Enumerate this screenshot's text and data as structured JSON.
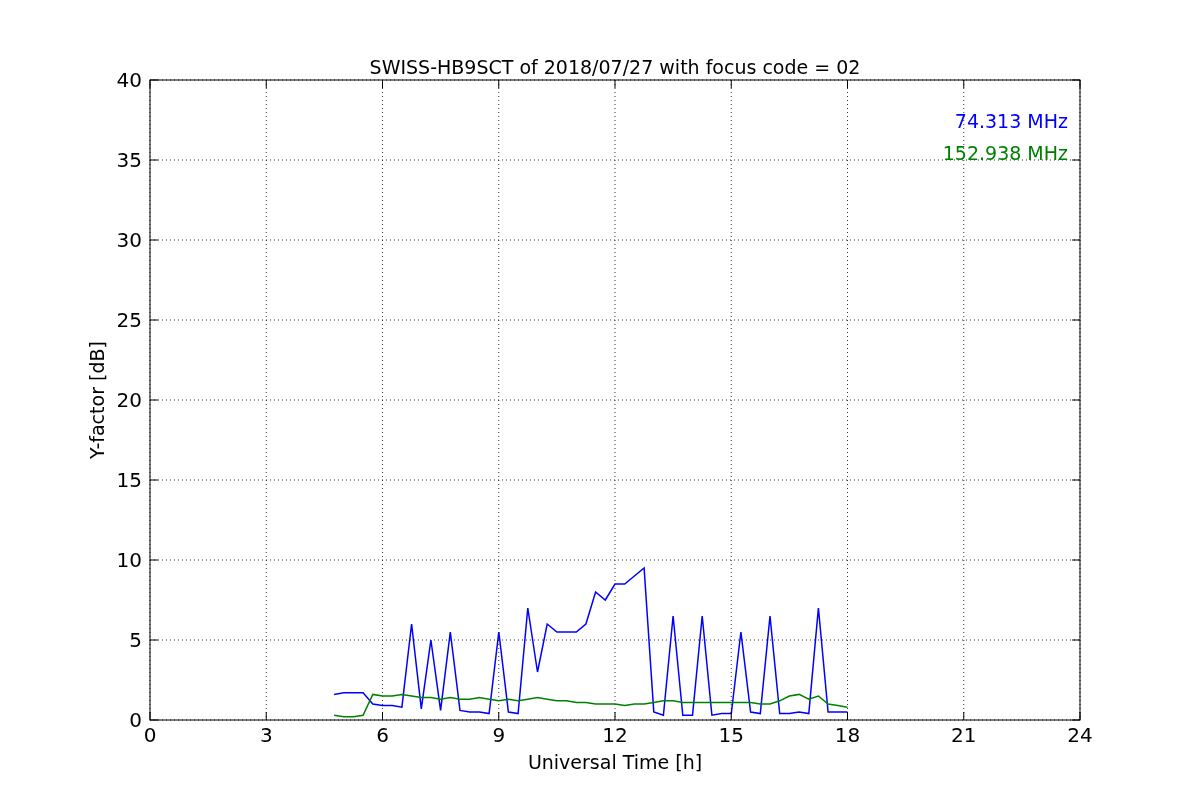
{
  "chart_data": {
    "type": "line",
    "title": "SWISS-HB9SCT of 2018/07/27 with focus code = 02",
    "xlabel": "Universal Time [h]",
    "ylabel": "Y-factor [dB]",
    "x": [
      4.75,
      5.0,
      5.25,
      5.5,
      5.75,
      6.0,
      6.25,
      6.5,
      6.75,
      7.0,
      7.25,
      7.5,
      7.75,
      8.0,
      8.25,
      8.5,
      8.75,
      9.0,
      9.25,
      9.5,
      9.75,
      10.0,
      10.25,
      10.5,
      10.75,
      11.0,
      11.25,
      11.5,
      11.75,
      12.0,
      12.25,
      12.5,
      12.75,
      13.0,
      13.25,
      13.5,
      13.75,
      14.0,
      14.25,
      14.5,
      14.75,
      15.0,
      15.25,
      15.5,
      15.75,
      16.0,
      16.25,
      16.5,
      16.75,
      17.0,
      17.25,
      17.5,
      17.75,
      18.0
    ],
    "series": [
      {
        "name": "74.313 MHz",
        "color": "#0000ff",
        "values": [
          1.6,
          1.7,
          1.7,
          1.7,
          1.0,
          0.9,
          0.9,
          0.8,
          6.0,
          0.7,
          5.0,
          0.6,
          5.5,
          0.6,
          0.5,
          0.5,
          0.4,
          5.5,
          0.5,
          0.4,
          7.0,
          3.0,
          6.0,
          5.5,
          5.5,
          5.5,
          6.0,
          8.0,
          7.5,
          8.5,
          8.5,
          9.0,
          9.5,
          0.5,
          0.3,
          6.5,
          0.3,
          0.3,
          6.5,
          0.3,
          0.4,
          0.4,
          5.5,
          0.5,
          0.4,
          6.5,
          0.4,
          0.4,
          0.5,
          0.4,
          7.0,
          0.5,
          0.5,
          0.5
        ]
      },
      {
        "name": "152.938 MHz",
        "color": "#008000",
        "values": [
          0.3,
          0.2,
          0.2,
          0.3,
          1.6,
          1.5,
          1.5,
          1.6,
          1.5,
          1.4,
          1.4,
          1.3,
          1.4,
          1.3,
          1.3,
          1.4,
          1.3,
          1.2,
          1.3,
          1.2,
          1.3,
          1.4,
          1.3,
          1.2,
          1.2,
          1.1,
          1.1,
          1.0,
          1.0,
          1.0,
          0.9,
          1.0,
          1.0,
          1.1,
          1.2,
          1.2,
          1.1,
          1.1,
          1.1,
          1.1,
          1.1,
          1.1,
          1.1,
          1.1,
          1.0,
          1.0,
          1.2,
          1.5,
          1.6,
          1.3,
          1.5,
          1.0,
          0.9,
          0.8
        ]
      }
    ],
    "grid": true,
    "xlim": [
      0,
      24
    ],
    "ylim": [
      0,
      40
    ],
    "xticks": [
      0,
      3,
      6,
      9,
      12,
      15,
      18,
      21,
      24
    ],
    "yticks": [
      0,
      5,
      10,
      15,
      20,
      25,
      30,
      35,
      40
    ]
  }
}
